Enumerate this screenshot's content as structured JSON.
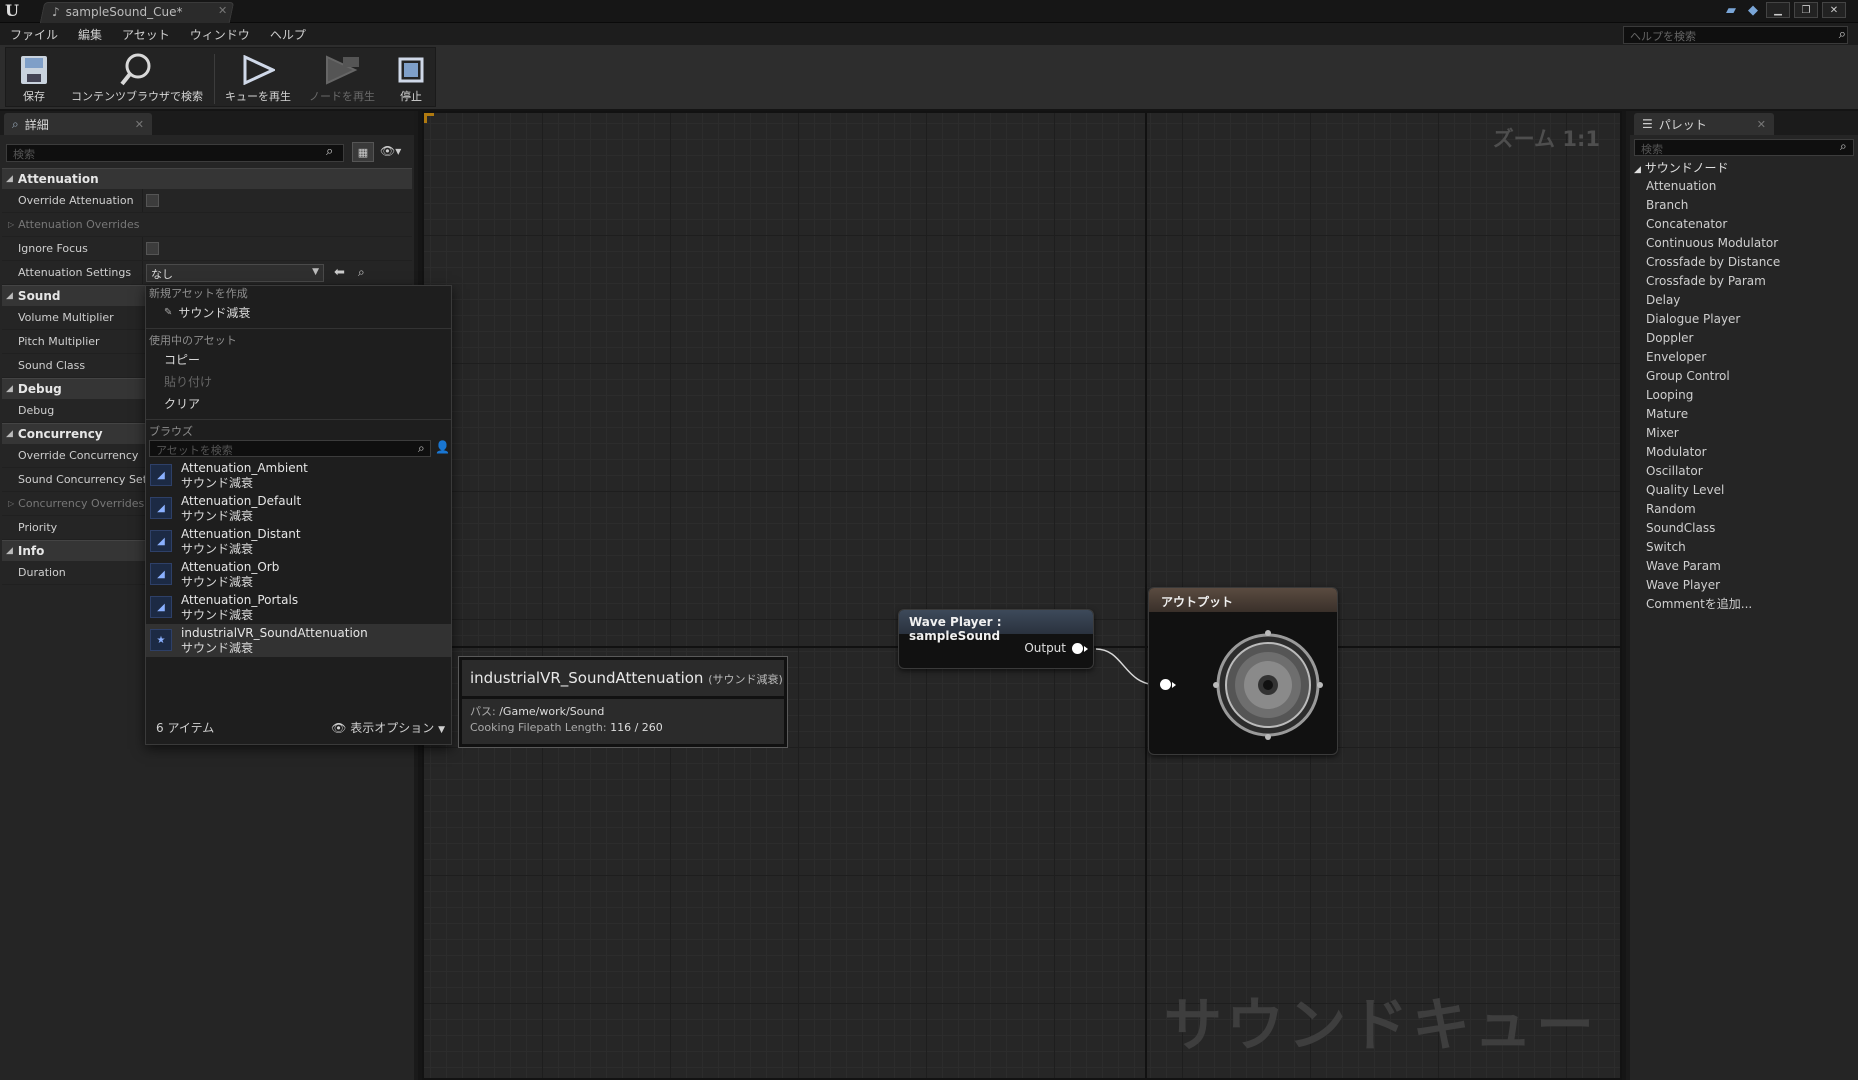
{
  "titlebar": {
    "tab_title": "sampleSound_Cue*",
    "logo_text": "U"
  },
  "menu": [
    "ファイル",
    "編集",
    "アセット",
    "ウィンドウ",
    "ヘルプ"
  ],
  "help_search": {
    "placeholder": "ヘルプを検索"
  },
  "toolbar": [
    {
      "label": "保存",
      "icon": "save-icon",
      "enabled": true
    },
    {
      "label": "コンテンツブラウザで検索",
      "icon": "magnifier-icon",
      "enabled": true
    },
    {
      "label": "キューを再生",
      "icon": "play-cue-icon",
      "enabled": true
    },
    {
      "label": "ノードを再生",
      "icon": "play-node-icon",
      "enabled": false
    },
    {
      "label": "停止",
      "icon": "stop-icon",
      "enabled": true
    }
  ],
  "details": {
    "tab_label": "詳細",
    "search_placeholder": "検索",
    "categories": {
      "attenuation": {
        "label": "Attenuation",
        "props": [
          "Override Attenuation",
          "Attenuation Overrides",
          "Ignore Focus",
          "Attenuation Settings"
        ]
      },
      "sound": {
        "label": "Sound",
        "props": [
          "Volume Multiplier",
          "Pitch Multiplier",
          "Sound Class"
        ]
      },
      "debug": {
        "label": "Debug",
        "props": [
          "Debug"
        ]
      },
      "concurrency": {
        "label": "Concurrency",
        "props": [
          "Override Concurrency",
          "Sound Concurrency Sett",
          "Concurrency Overrides",
          "Priority"
        ]
      },
      "info": {
        "label": "Info",
        "props": [
          "Duration"
        ]
      }
    },
    "attenuation_settings_value": "なし"
  },
  "popup": {
    "create_header": "新規アセットを作成",
    "create_item": "サウンド減衰",
    "current_header": "使用中のアセット",
    "copy": "コピー",
    "paste": "貼り付け",
    "clear": "クリア",
    "browse_header": "ブラウズ",
    "asset_search_placeholder": "アセットを検索",
    "assets": [
      {
        "name": "Attenuation_Ambient",
        "type": "サウンド減衰"
      },
      {
        "name": "Attenuation_Default",
        "type": "サウンド減衰"
      },
      {
        "name": "Attenuation_Distant",
        "type": "サウンド減衰"
      },
      {
        "name": "Attenuation_Orb",
        "type": "サウンド減衰"
      },
      {
        "name": "Attenuation_Portals",
        "type": "サウンド減衰"
      },
      {
        "name": "industrialVR_SoundAttenuation",
        "type": "サウンド減衰"
      }
    ],
    "item_count": "6 アイテム",
    "view_options": "表示オプション"
  },
  "tooltip": {
    "name": "industrialVR_SoundAttenuation",
    "type": "(サウンド減衰)",
    "path_label": "パス:",
    "path_value": "/Game/work/Sound",
    "cooking_label": "Cooking Filepath Length:",
    "cooking_value": "116 / 260"
  },
  "graph": {
    "zoom": "ズーム 1:1",
    "watermark": "サウンドキュー",
    "wave_node_title": "Wave Player : sampleSound",
    "wave_output_label": "Output",
    "output_node_title": "アウトプット"
  },
  "palette": {
    "tab_label": "パレット",
    "search_placeholder": "検索",
    "category": "サウンドノード",
    "items": [
      "Attenuation",
      "Branch",
      "Concatenator",
      "Continuous Modulator",
      "Crossfade by Distance",
      "Crossfade by Param",
      "Delay",
      "Dialogue Player",
      "Doppler",
      "Enveloper",
      "Group Control",
      "Looping",
      "Mature",
      "Mixer",
      "Modulator",
      "Oscillator",
      "Quality Level",
      "Random",
      "SoundClass",
      "Switch",
      "Wave Param",
      "Wave Player",
      "Commentを追加..."
    ]
  }
}
